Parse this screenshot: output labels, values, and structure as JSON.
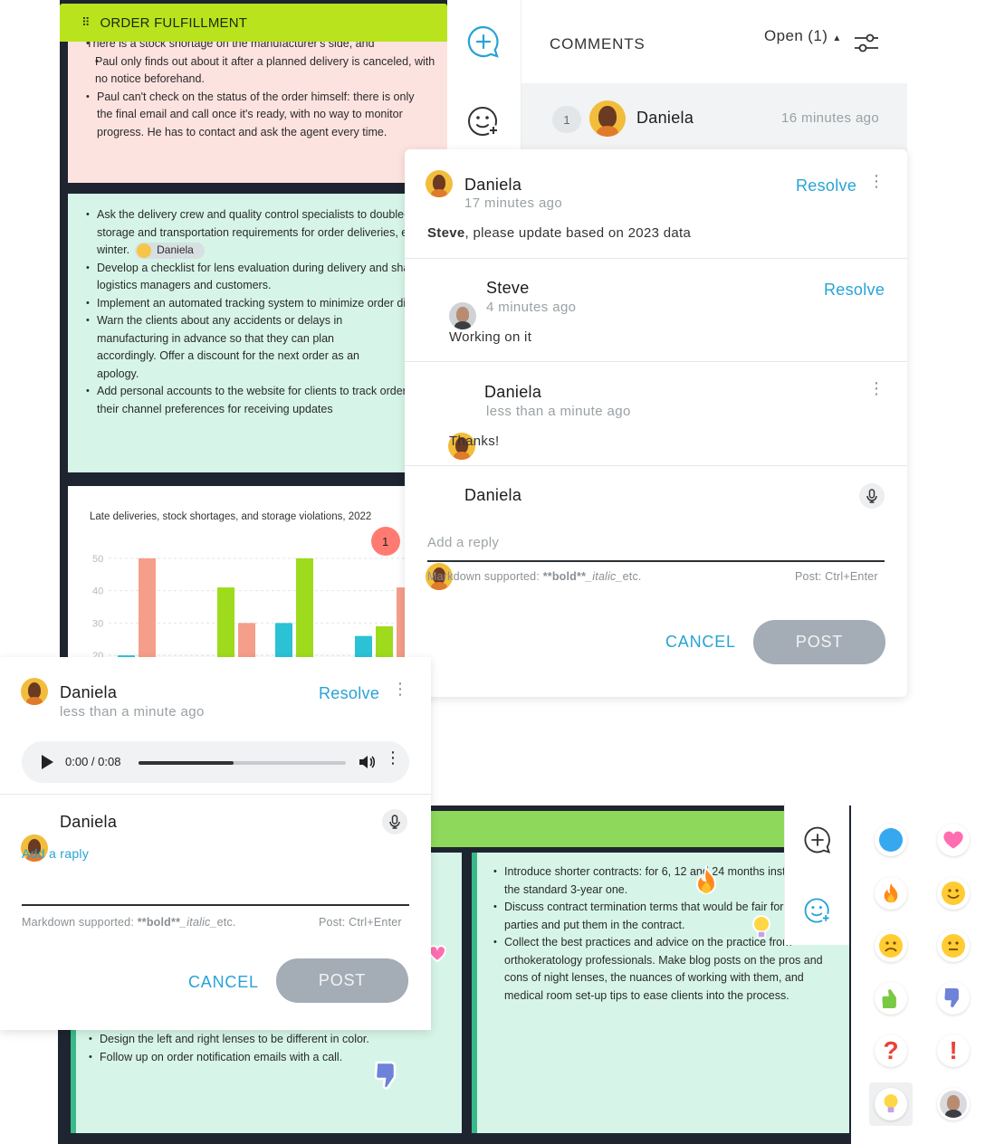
{
  "frame": {
    "title": "ORDER FULFILLMENT"
  },
  "note_pink": {
    "items": [
      "There is a stock shortage on the manufacturer's side, and",
      "Paul only finds out about it after a planned delivery is canceled, with no notice beforehand.",
      "Paul can't check on the status of the order himself: there is only the final email and call once it's ready, with no way to monitor progress. He has to contact and ask the agent every time."
    ]
  },
  "note_green": {
    "item1": "Ask the delivery crew and quality control specialists to double-check the storage and transportation requirements for order deliveries, especially in winter.",
    "tag": "Daniela",
    "item2": "Develop a checklist for lens evaluation during delivery and share it with both logistics managers and customers.",
    "item3": "Implement an automated tracking system to minimize order discrepancies.",
    "item4": "Warn the clients about any accidents or delays in manufacturing in advance so that they can plan accordingly. Offer a discount for the next order as an apology.",
    "item5": "Add personal accounts to the website for clients to track orders and set up their channel preferences for receiving updates"
  },
  "chart_data": {
    "type": "bar",
    "title": "Late deliveries, stock shortages, and storage violations, 2022",
    "xlabel": "",
    "ylabel": "",
    "yticks": [
      "50",
      "40",
      "30",
      "20"
    ],
    "ylim": [
      15,
      55
    ],
    "grid": true,
    "badge": "1",
    "series": [
      {
        "color": "#2bc2d6",
        "values": [
          20,
          16,
          30,
          26
        ]
      },
      {
        "color": "#f59e8a",
        "values": [
          50,
          30,
          null,
          41
        ]
      },
      {
        "color": "#9edb1c",
        "values": [
          41,
          50,
          29,
          null
        ]
      }
    ],
    "groups": [
      {
        "x": 0,
        "bars": [
          [
            "#2bc2d6",
            20
          ],
          [
            "#f59e8a",
            50
          ]
        ]
      },
      {
        "x": 1,
        "bars": [
          [
            "#2bc2d6",
            16
          ],
          [
            "#9edb1c",
            41
          ],
          [
            "#f59e8a",
            30
          ]
        ]
      },
      {
        "x": 2,
        "bars": [
          [
            "#2bc2d6",
            30
          ],
          [
            "#9edb1c",
            50
          ]
        ]
      },
      {
        "x": 3,
        "bars": [
          [
            "#2bc2d6",
            26
          ],
          [
            "#9edb1c",
            29
          ],
          [
            "#f59e8a",
            41
          ]
        ]
      }
    ]
  },
  "comments_header": {
    "title": "COMMENTS",
    "filter": "Open (1)",
    "thread_count": "1",
    "thread_author": "Daniela",
    "thread_time": "16 minutes ago"
  },
  "panel": {
    "c1": {
      "author": "Daniela",
      "time": "17 minutes ago",
      "resolve": "Resolve",
      "mention": "Steve",
      "text": ", please update based on 2023 data"
    },
    "c2": {
      "author": "Steve",
      "time": "4 minutes ago",
      "resolve": "Resolve",
      "text": "Working on it"
    },
    "c3": {
      "author": "Daniela",
      "time": "less than a minute ago",
      "text": "Thanks!"
    },
    "reply": {
      "author": "Daniela",
      "placeholder": "Add a reply",
      "hint": "Markdown supported:",
      "hint_bold": "**bold**",
      "hint_italic": "_italic_",
      "hint_etc": "etc.",
      "post_hint": "Post:  Ctrl+Enter",
      "cancel": "CANCEL",
      "post": "POST"
    }
  },
  "audio_comment": {
    "author": "Daniela",
    "time": "less than a minute ago",
    "resolve": "Resolve",
    "player_time": "0:00 / 0:08",
    "progress": 0.46,
    "reply_author": "Daniela",
    "reply_placeholder": "Add a raply",
    "hint": "Markdown supported:",
    "hint_bold": "**bold**",
    "hint_italic": "_italic_",
    "hint_etc": "etc.",
    "post_hint": "Post:  Ctrl+Enter",
    "cancel": "CANCEL",
    "post": "POST"
  },
  "note2_left": {
    "items": [
      "Design the left and right lenses to be different in color.",
      "Follow up on order notification emails with a call."
    ]
  },
  "note2_right": {
    "items": [
      "Introduce shorter contracts: for 6, 12 and 24 months instead of the standard 3-year one.",
      "Discuss contract termination terms that would be fair for both parties and put them in the contract.",
      "Collect the best practices and advice on the practice from orthokeratology professionals. Make blog posts on the pros and cons of night lenses, the nuances of working with them, and medical room set-up tips to ease clients into the process."
    ]
  },
  "reactions": [
    "blue-circle-icon",
    "heart-icon",
    "fire-icon",
    "smile-icon",
    "sad-icon",
    "neutral-icon",
    "thumbs-up-icon",
    "thumbs-down-icon",
    "question-icon",
    "exclamation-icon",
    "lightbulb-icon",
    "avatar-sticker-icon"
  ]
}
